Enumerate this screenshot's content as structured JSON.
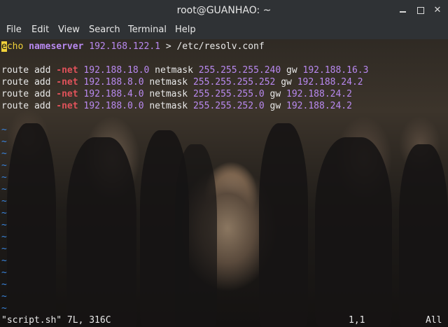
{
  "window": {
    "title": "root@GUANHAO: ~"
  },
  "menu": [
    "File",
    "Edit",
    "View",
    "Search",
    "Terminal",
    "Help"
  ],
  "editor": {
    "line1": {
      "cursor_char": "e",
      "kw_rest": "cho",
      "cmd": "nameserver",
      "ip": "192.168.122.1",
      "rest": " > /etc/resolv.conf"
    },
    "routes": [
      {
        "pre": "route add ",
        "opt": "-net",
        "net": "192.188.18.0",
        "mid": " netmask ",
        "mask": "255.255.255.240",
        "gw": " gw ",
        "gwip": "192.188.16.3"
      },
      {
        "pre": "route add ",
        "opt": "-net",
        "net": "192.188.8.0",
        "mid": " netmask ",
        "mask": "255.255.255.252",
        "gw": " gw ",
        "gwip": "192.188.24.2"
      },
      {
        "pre": "route add ",
        "opt": "-net",
        "net": "192.188.4.0",
        "mid": " netmask ",
        "mask": "255.255.255.0",
        "gw": " gw ",
        "gwip": "192.188.24.2"
      },
      {
        "pre": "route add ",
        "opt": "-net",
        "net": "192.188.0.0",
        "mid": " netmask ",
        "mask": "255.255.252.0",
        "gw": " gw ",
        "gwip": "192.188.24.2"
      }
    ],
    "tilde": "~"
  },
  "status": {
    "file": "\"script.sh\" 7L, 316C",
    "position": "1,1",
    "scroll": "All"
  },
  "colors": {
    "keyword": "#f2d23a",
    "number": "#b989f0",
    "option": "#e0525a",
    "tilde": "#3a86e0"
  }
}
